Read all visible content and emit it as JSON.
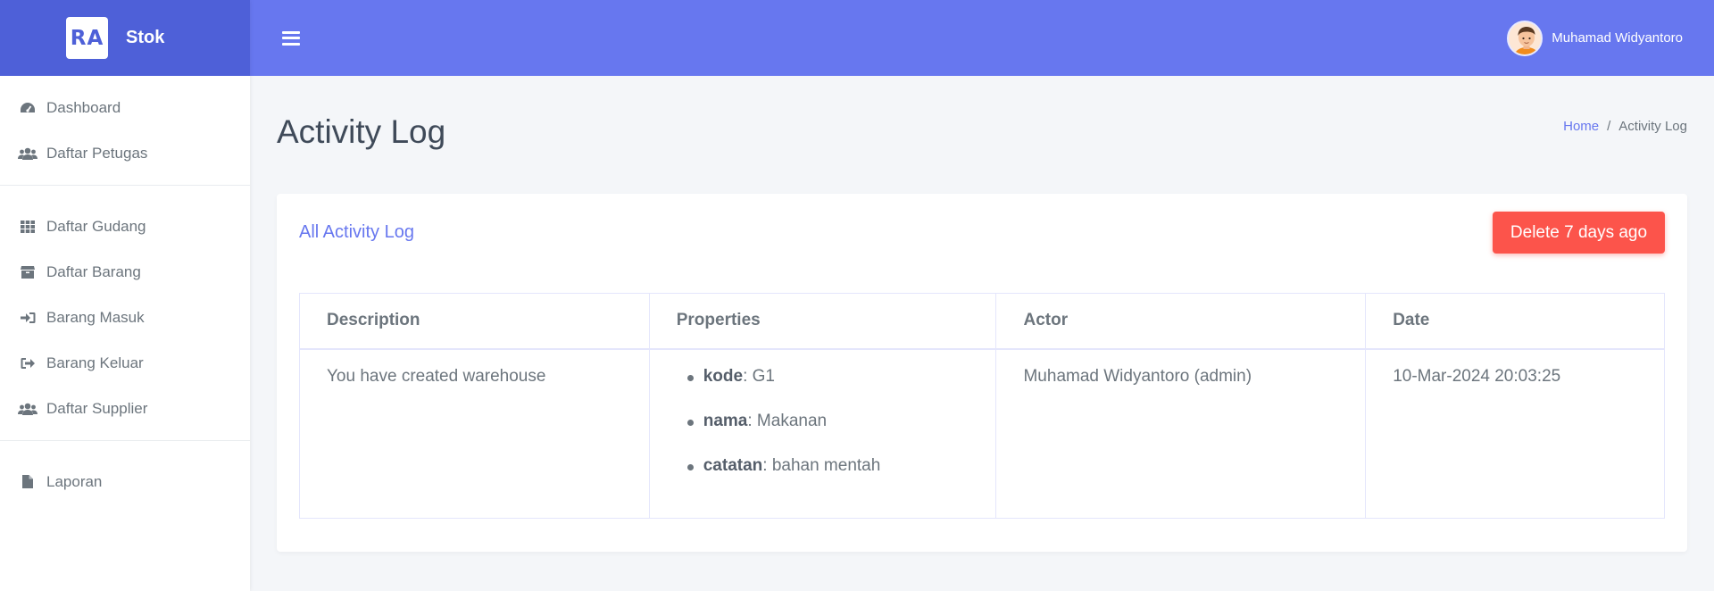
{
  "brand": {
    "logo_text": "RA",
    "name": "Stok",
    "color": "#4e60d8"
  },
  "topbar": {
    "color": "#6777ef",
    "user_name": "Muhamad Widyantoro"
  },
  "sidebar": {
    "items": [
      {
        "label": "Dashboard",
        "icon": "tachometer-icon"
      },
      {
        "label": "Daftar Petugas",
        "icon": "users-icon"
      },
      {
        "label": "Daftar Gudang",
        "icon": "grid-icon"
      },
      {
        "label": "Daftar Barang",
        "icon": "box-icon"
      },
      {
        "label": "Barang Masuk",
        "icon": "sign-in-icon"
      },
      {
        "label": "Barang Keluar",
        "icon": "sign-out-icon"
      },
      {
        "label": "Daftar Supplier",
        "icon": "users-icon"
      },
      {
        "label": "Laporan",
        "icon": "file-icon"
      }
    ]
  },
  "page": {
    "title": "Activity Log",
    "breadcrumb": {
      "home": "Home",
      "separator": "/",
      "current": "Activity Log"
    }
  },
  "card": {
    "title": "All Activity Log",
    "delete_button": "Delete 7 days ago",
    "delete_color": "#fc544b"
  },
  "table": {
    "headers": [
      "Description",
      "Properties",
      "Actor",
      "Date"
    ],
    "rows": [
      {
        "description": "You have created warehouse",
        "properties": [
          {
            "key": "kode",
            "value": ": G1"
          },
          {
            "key": "nama",
            "value": ": Makanan"
          },
          {
            "key": "catatan",
            "value": ": bahan mentah"
          }
        ],
        "actor": "Muhamad Widyantoro (admin)",
        "date": "10-Mar-2024 20:03:25"
      }
    ]
  }
}
